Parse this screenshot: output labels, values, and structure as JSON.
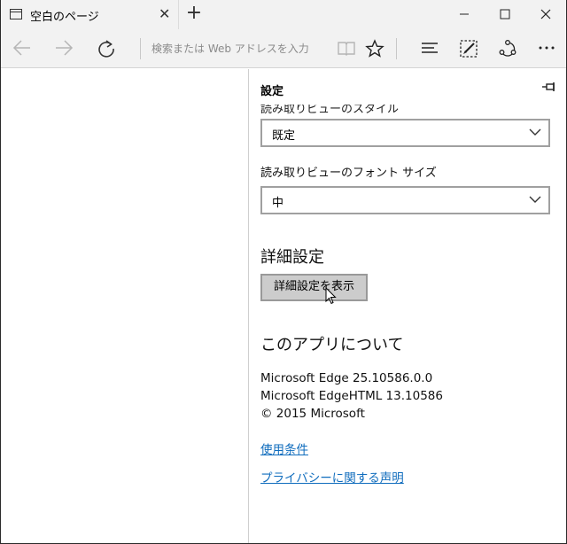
{
  "tab": {
    "title": "空白のページ",
    "close_label": "✕"
  },
  "new_tab_label": "+",
  "address": {
    "placeholder": "検索または Web アドレスを入力"
  },
  "panel": {
    "title": "設定",
    "cut_label": "読み取りビューのスタイル",
    "style_select": {
      "value": "既定"
    },
    "font_size_label": "読み取りビューのフォント サイズ",
    "font_size_select": {
      "value": "中"
    },
    "advanced_heading": "詳細設定",
    "advanced_button": "詳細設定を表示",
    "about_heading": "このアプリについて",
    "about_lines": [
      "Microsoft Edge 25.10586.0.0",
      "Microsoft EdgeHTML 13.10586",
      "© 2015 Microsoft"
    ],
    "links": [
      "使用条件",
      "プライバシーに関する声明"
    ]
  },
  "icons": [
    "page-icon",
    "back-arrow-icon",
    "forward-arrow-icon",
    "refresh-icon",
    "reading-view-icon",
    "favorite-star-icon",
    "hub-icon",
    "web-note-icon",
    "share-icon",
    "more-icon",
    "pin-icon",
    "chevron-down-icon"
  ]
}
